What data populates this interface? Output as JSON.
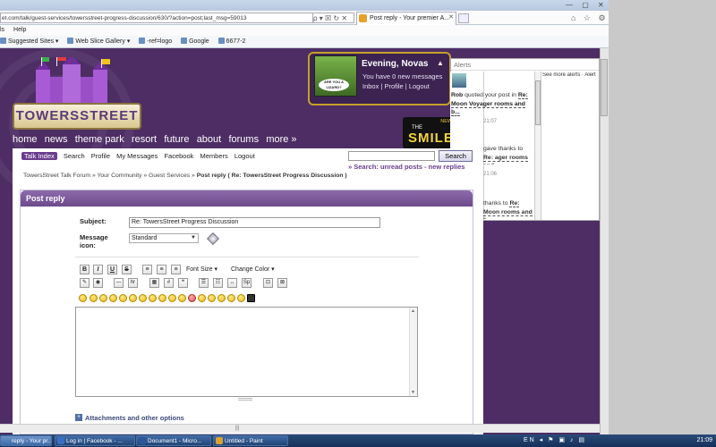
{
  "browser": {
    "url": "et.com/talk/guest-services/towersstreet-progress-discussion/630/?action=post;last_msg=59013",
    "tab_title": "Post reply - Your premier A...",
    "tab_close": "✕",
    "menu": [
      "ls",
      "Help"
    ],
    "favorites": [
      "Suggested Sites ▾",
      "Web Slice Gallery ▾",
      "-ref=logo",
      "Google",
      "6677-2"
    ],
    "url_icons": "ρ ▾ ☒ ↻ ✕",
    "window_controls": "— ▢ ✕",
    "right_glyphs": "⌂ ☆ ⚙"
  },
  "site": {
    "logo": "TOWERSSTREET",
    "nav": [
      "home",
      "news",
      "theme park",
      "resort",
      "future",
      "about",
      "forums",
      "more »"
    ],
    "greeting": "Evening, Novas",
    "messages": "You have 0 new messages",
    "user_links": "Inbox | Profile | Logout",
    "avatar_caption": "ARE YOU A LIZARD?",
    "ad_new": "NEW FOR 2013",
    "ad_the": "THE",
    "ad_word": "SMILER"
  },
  "alerts": {
    "header": "Alerts",
    "see_more": "See more alerts · Alert",
    "item1": {
      "user": "Rob",
      "text": " quoted your post in ",
      "topic": "Re: Moon Voyager rooms and b...",
      "time": "21:07"
    },
    "item2": {
      "text": "gave thanks to ",
      "topic": "Re: ager rooms and",
      "time": "21:06"
    },
    "item3": {
      "text": "thanks to ",
      "topic": "Re: Moon rooms and b..."
    }
  },
  "forum": {
    "subnav": [
      "Talk Index",
      "Search",
      "Profile",
      "My Messages",
      "Facebook",
      "Members",
      "Logout"
    ],
    "search_button": "Search",
    "search_links": "» Search: unread posts - new replies",
    "breadcrumb": [
      "TowersStreet Talk Forum",
      "»",
      "Your Community",
      "»",
      "Guest Services",
      "»"
    ],
    "breadcrumb_current": "Post reply",
    "breadcrumb_tail": "( Re: TowersStreet Progress Discussion )",
    "panel_title": "Post reply",
    "subject_label": "Subject:",
    "subject_value": "Re: TowersStreet Progress Discussion",
    "icon_label": "Message icon:",
    "icon_value": "Standard",
    "font_size": "Font Size ▾",
    "change_color": "Change Color ▾",
    "toolbar1": [
      "B",
      "I",
      "U",
      "S",
      "≡",
      "≡",
      "≡"
    ],
    "toolbar2": [
      "✎",
      "◉",
      "—",
      "hr",
      "T",
      "▦",
      "#",
      "❝",
      "☰",
      "☷",
      "↔",
      "Sp",
      "⊡",
      "⊠"
    ],
    "attachments": "Attachments and other options"
  },
  "taskbar": {
    "tasks": [
      "reply - Your pr...",
      "Log in | Facebook - ...",
      "Document1 - Micro...",
      "Untitled - Paint"
    ],
    "tray": "EN ◂ ⚑ ▣ ♪ ▤",
    "clock": "21:09"
  }
}
